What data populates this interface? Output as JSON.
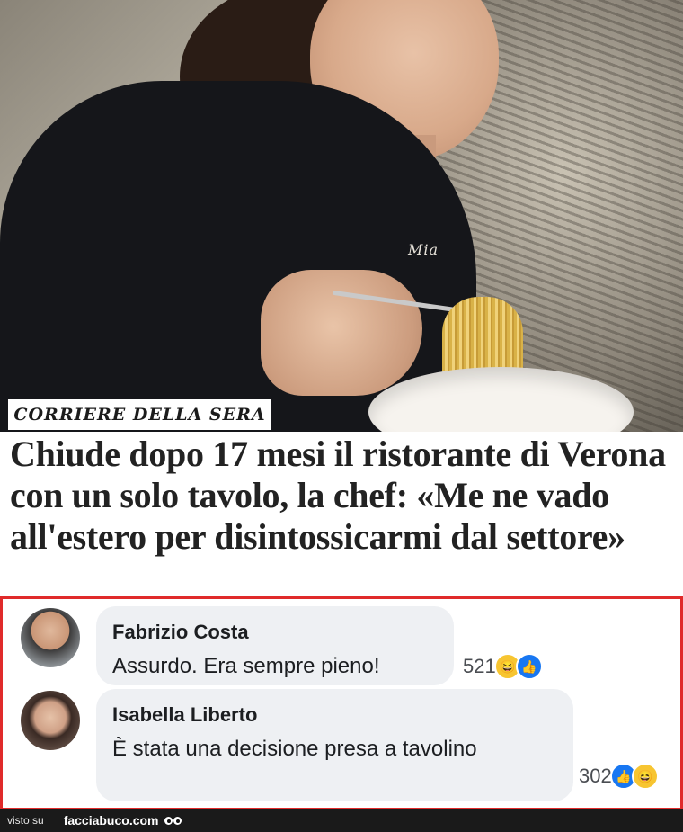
{
  "article": {
    "source": "CORRIERE DELLA SERA",
    "jacket_text": "Mia",
    "headline": "Chiude dopo 17 mesi il ristorante di Verona con un solo tavolo, la chef: «Me ne vado all'estero per disintossicarmi dal settore»"
  },
  "comments": [
    {
      "author": "Fabrizio Costa",
      "text": "Assurdo. Era sempre pieno!",
      "reaction_count": "521",
      "reactions": [
        "haha-icon",
        "like-icon"
      ]
    },
    {
      "author": "Isabella Liberto",
      "text": "È stata una decisione presa a tavolino",
      "reaction_count": "302",
      "reactions": [
        "like-icon",
        "haha-icon"
      ]
    }
  ],
  "footer": {
    "prefix": "visto su",
    "site": "facciabuco.com"
  },
  "colors": {
    "frame_border": "#e02a2a",
    "bubble_bg": "#eef0f3",
    "like_blue": "#1877f2",
    "haha_yellow": "#f7c531"
  }
}
